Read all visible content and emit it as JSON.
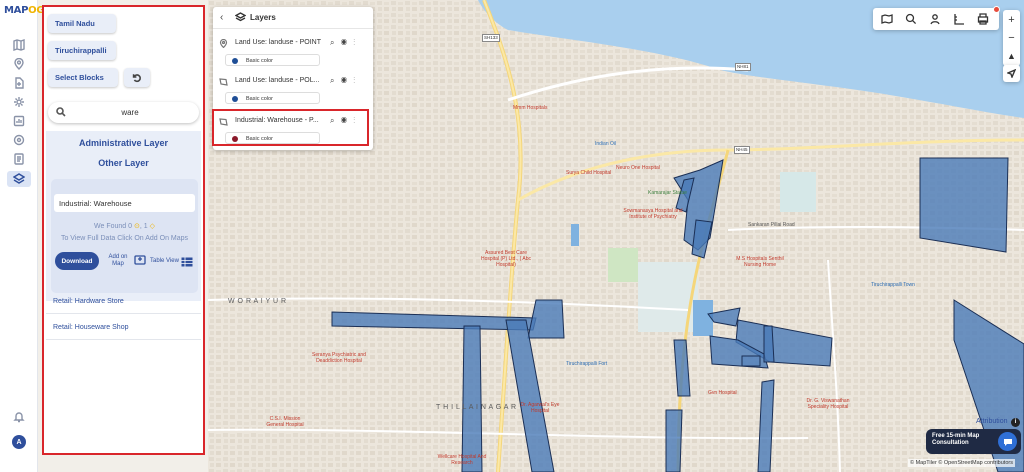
{
  "app": {
    "logo_main": "MAP",
    "logo_accent": "OG"
  },
  "user": {
    "avatar_initial": "A"
  },
  "panel": {
    "state_chip": "Tamil Nadu",
    "district_chip": "Tiruchirappalli",
    "blocks_chip": "Select Blocks",
    "search": {
      "value": "ware",
      "placeholder": "Search"
    },
    "admin_layer_title": "Administrative Layer",
    "other_layer_title": "Other Layer",
    "result": {
      "field_value": "Industrial: Warehouse",
      "found_label": "We Found",
      "found_points": "0",
      "found_polygons": "1",
      "view_hint": "To View Full Data Click On Add On Maps",
      "download_label": "Download",
      "add_on_map_label": "Add on Map",
      "table_view_label": "Table View"
    },
    "list": [
      "Retail: Hardware Store",
      "Retail: Houseware Shop"
    ]
  },
  "layers_panel": {
    "title": "Layers",
    "items": [
      {
        "name": "Land Use: landuse - POINT",
        "color_label": "Basic color",
        "color": "#1f4e96",
        "type_icon": "pin-icon"
      },
      {
        "name": "Land Use: landuse - POL...",
        "color_label": "Basic color",
        "color": "#1f4e96",
        "type_icon": "polygon-icon"
      },
      {
        "name": "Industrial: Warehouse - P...",
        "color_label": "Basic color",
        "color": "#8b1a2b",
        "type_icon": "polygon-icon"
      }
    ]
  },
  "map": {
    "attribution": "Attribution",
    "consult_line1": "Free 15-min Map",
    "consult_line2": "Consultation",
    "copyright": "© MapTiler © OpenStreetMap contributors",
    "zoom_in": "+",
    "zoom_out": "−",
    "labels": {
      "worayur": "W O R A I Y U R",
      "thillai": "T H I L L A I   N A G A R",
      "mmm": "Mmm Hospitals",
      "indian_oil": "Indian Oil",
      "neuro": "Neuro One Hospital",
      "surya": "Surya Child Hospital",
      "kamaraj": "Kamarajar Statue",
      "sowmanasya": "Sowmanasya Hospital and Institute of Psychiatry",
      "assured": "Assured Best Care Hospital (P) Ltd., ( Abc Hospital)",
      "ms": "M.S Hospitals Senthil Nursing Home",
      "tiruchirappalli_town": "Tiruchirappalli Town",
      "seranya": "Seranya Psychiatric and Deaddiction Hospital",
      "fort": "Tiruchirappalli Fort",
      "gvn": "Gvn Hospital",
      "csi": "C.S.I. Mission General Hospital",
      "agarwal": "Dr. Agarwal's Eye Hospital",
      "viswanathan": "Dr. G. Viswanathan Speciality Hospital",
      "wellcare": "Wellcare Hospital And Research",
      "sankaran": "Sankaran Pillai Road",
      "sh": "SH133",
      "nh": "NH81",
      "nh2": "NH45"
    }
  },
  "colors": {
    "accent": "#2f4f9c",
    "highlight": "#d9262b",
    "water": "#a9cfee",
    "polygon": "#4a7ab8"
  }
}
